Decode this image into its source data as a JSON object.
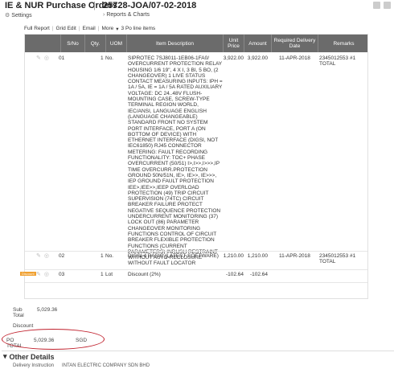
{
  "header": {
    "title": "IE & NUR Purchase Orders",
    "separator": "|",
    "doc_title": "25728-JOA/07-02-2018",
    "settings_label": "Settings",
    "reports_label": "Reports & Charts"
  },
  "toolbar": {
    "full_report": "Full Report",
    "grid_edit": "Grid Edit",
    "email": "Email",
    "more": "More",
    "po_line_items": "3 Po line items"
  },
  "columns": [
    "S/No",
    "Qty.",
    "UOM",
    "Item Description",
    "Unit Price",
    "Amount",
    "Required Delivery Date",
    "Remarks"
  ],
  "rows": [
    {
      "sno": "01",
      "qty": "1",
      "uom": "No.",
      "description": "SIPROTEC 7SJ8011-1EB06-1FA0/ OVERCURRENT PROTECTION RELAY HOUSING 1/6 19\", 4 X I, 3 BI, 5 BO, (2 CHANGEOVER) 1 LIVE STATUS CONTACT MEASURING INPUTS: IPH = 1A / 5A, IE = 1A / 5A RATED AUXILIARY VOLTAGE: DC 24..48V FLUSH-MOUNTING CASE, SCREW-TYPE TERMINAL REGION WORLD, IEC/ANSI, LANGUAGE ENGLISH (LANGUAGE CHANGEABLE) STANDARD FRONT NO SYSTEM PORT INTERFACE, PORT A (ON BOTTOM OF DEVICE) WITH ETHERNET INTERFACE (DIGSI, NOT IEC61850) RJ45 CONNECTOR METERING: FAULT RECORDING FUNCTIONALITY: TOC+ PHASE OVERCURRENT (50/51) I>,I>>,I>>>,IP TIME OVERCURR.PROTECTION GROUND 50N/51N, IE>, IE>>, IE>>>, IEP GROUND FAULT PROTECTION IEE>,IEE>>,IEEP OVERLOAD PROTECTION (49) TRIP CIRCUIT SUPERVISION (74TC) CIRCUIT BREAKER FAILURE PROTECT NEGATIVE SEQUENCE PROTECTION UNDERCURRENT MONITORING (37) LOCK OUT (86) PARAMETER CHANGEOVER MONITORING FUNCTIONS CONTROL OF CIRCUIT BREAKER FLEXIBLE PROTECTION FUNCTIONS (CURRENT PARAMETERS) INRUSH RESTRAINT WITHOUT AUTO-RECLOSURE WITHOUT FAULT LOCATOR",
      "unit_price": "3,922.00",
      "amount": "3,922.00",
      "delivery": "11-APR-2018",
      "remarks": "2345012553 #1 TOTAL"
    },
    {
      "sno": "02",
      "qty": "1",
      "uom": "No.",
      "description": "DIGSI 4 BASIC (LATEST SOFTWARE)",
      "unit_price": "1,210.00",
      "amount": "1,210.00",
      "delivery": "11-APR-2018",
      "remarks": "2345012553 #1 TOTAL"
    },
    {
      "tag": "Discount",
      "sno": "03",
      "qty": "1",
      "uom": "Lot",
      "description": "Discount (2%)",
      "unit_price": "-102.64",
      "amount": "-102.64",
      "delivery": "",
      "remarks": ""
    }
  ],
  "totals": {
    "subtotal_label": "Sub Total",
    "subtotal_value": "5,029.36",
    "discount_label": "Discount",
    "po_total_label": "PO TOTAL",
    "po_total_value": "5,029.36",
    "currency": "SGD"
  },
  "other": {
    "title": "Other Details",
    "delivery_label": "Delivery Instruction",
    "delivery_value": "INTAN ELECTRIC COMPANY SDN BHD"
  },
  "colors": {
    "header_bg": "#6b6b6b",
    "annotation_red": "#c0202c",
    "tag_orange": "#f0a030"
  }
}
